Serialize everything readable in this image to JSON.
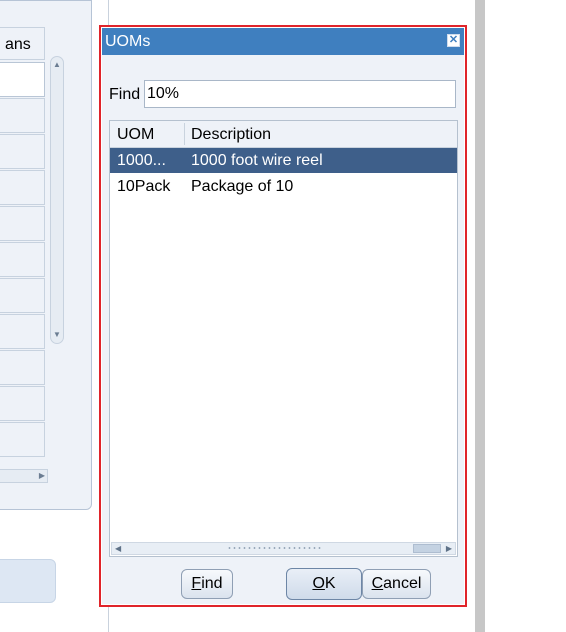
{
  "background": {
    "column_header": "ans"
  },
  "dialog": {
    "title": "UOMs",
    "find_label": "Find",
    "find_value": "10%",
    "columns": [
      "UOM",
      "Description"
    ],
    "rows": [
      {
        "uom": "1000...",
        "description": "1000 foot wire reel",
        "selected": true
      },
      {
        "uom": "10Pack",
        "description": "Package of 10",
        "selected": false
      }
    ],
    "buttons": {
      "find": {
        "mnemonic": "F",
        "rest": "ind"
      },
      "ok": {
        "mnemonic": "O",
        "rest": "K"
      },
      "cancel": {
        "mnemonic": "C",
        "rest": "ancel"
      }
    },
    "colors": {
      "titlebar": "#3f7fbf",
      "selected_row": "#3e5f8a",
      "highlight_border": "#e0242a"
    }
  }
}
